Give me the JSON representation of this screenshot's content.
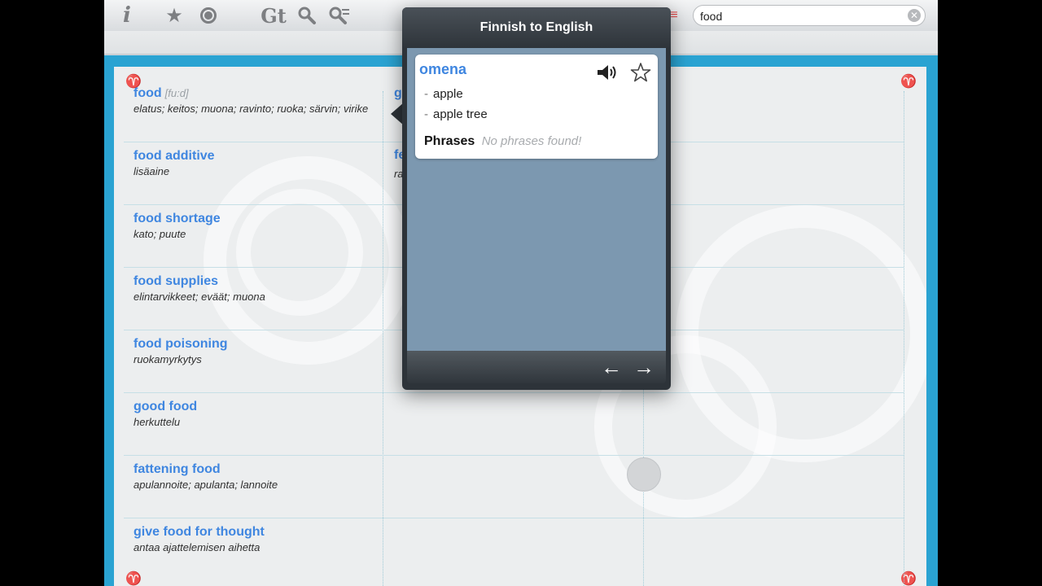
{
  "toolbar": {
    "info_glyph": "i",
    "gt_label": "Gt",
    "search": {
      "value": "food",
      "placeholder": ""
    }
  },
  "entries": [
    {
      "term": "food",
      "pron": "[fu:d]",
      "trans": "elatus; keitos; muona; ravinto; ruoka; särvin; virike"
    },
    {
      "term": "food additive",
      "pron": "",
      "trans": "lisäaine"
    },
    {
      "term": "food shortage",
      "pron": "",
      "trans": "kato; puute"
    },
    {
      "term": "food supplies",
      "pron": "",
      "trans": "elintarvikkeet; eväät; muona"
    },
    {
      "term": "food poisoning",
      "pron": "",
      "trans": "ruokamyrkytys"
    },
    {
      "term": "good food",
      "pron": "",
      "trans": "herkuttelu"
    },
    {
      "term": "fattening food",
      "pron": "",
      "trans": "apulannoite; apulanta; lannoite"
    },
    {
      "term": "give food for thought",
      "pron": "",
      "trans": "antaa ajattelemisen aihetta"
    }
  ],
  "column2_fragments": {
    "row1": "g",
    "row2": "fe",
    "row2_trans": "ra"
  },
  "popover": {
    "title": "Finnish to English",
    "word": "omena",
    "translations": [
      "apple",
      "apple tree"
    ],
    "dash": "-",
    "phrases_label": "Phrases",
    "phrases_empty": "No phrases found!",
    "back_glyph": "←",
    "forward_glyph": "→"
  }
}
